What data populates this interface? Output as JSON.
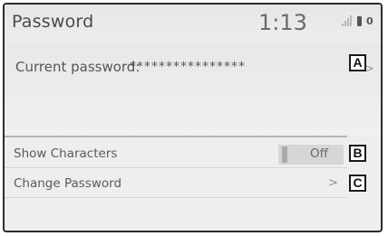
{
  "header": {
    "title": "Password",
    "clock": "1:13",
    "status_icons": [
      "signal-bars-icon",
      "battery-icon",
      "zero-indicator"
    ],
    "zero_text": "0"
  },
  "password": {
    "label": "Current password:",
    "value": "****************",
    "action_icon": "chevron-right-icon",
    "action_glyph": ">"
  },
  "settings": [
    {
      "label": "Show Characters",
      "toggle": {
        "state_label": "Off",
        "on": false
      }
    },
    {
      "label": "Change Password",
      "chevron": ">"
    }
  ],
  "callouts": [
    "A",
    "B",
    "C"
  ],
  "colors": {
    "screen_bg": "#eeeeee",
    "border": "#2c2c2c",
    "text": "#555555"
  }
}
